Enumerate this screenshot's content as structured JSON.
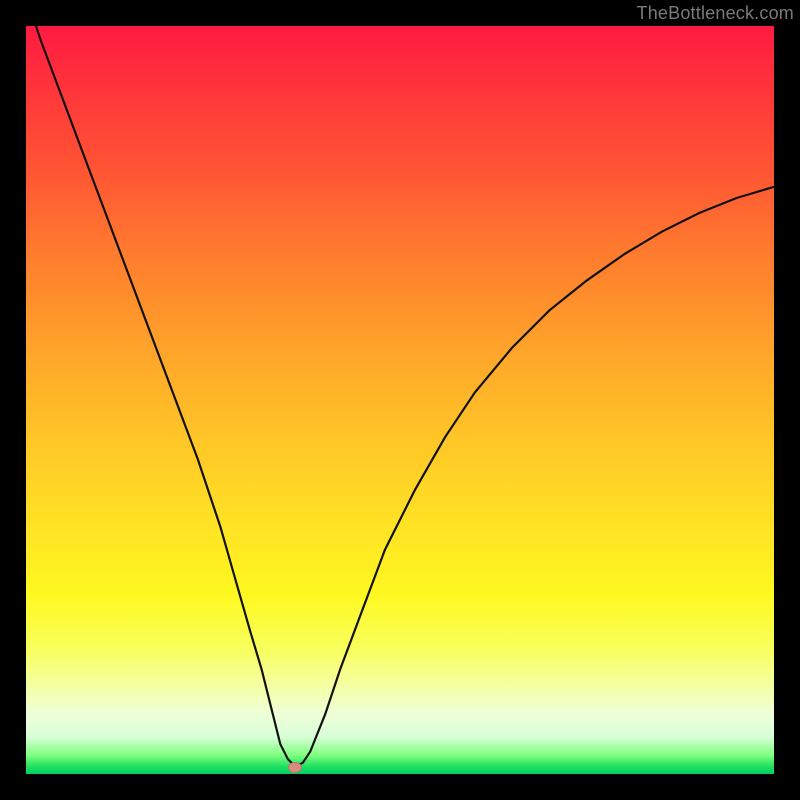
{
  "watermark": "TheBottleneck.com",
  "chart_data": {
    "type": "line",
    "title": "",
    "xlabel": "",
    "ylabel": "",
    "xlim": [
      0,
      100
    ],
    "ylim": [
      0,
      100
    ],
    "series": [
      {
        "name": "bottleneck-curve",
        "x": [
          0,
          2,
          5,
          8,
          11,
          14,
          17,
          20,
          23,
          26,
          28,
          30,
          31.5,
          33,
          34,
          35,
          36,
          37,
          38,
          40,
          42,
          45,
          48,
          52,
          56,
          60,
          65,
          70,
          75,
          80,
          85,
          90,
          95,
          100
        ],
        "y": [
          104,
          98,
          90,
          82,
          74,
          66,
          58,
          50,
          42,
          33,
          26,
          19,
          14,
          8,
          4,
          2,
          1,
          1.5,
          3,
          8,
          14,
          22,
          30,
          38,
          45,
          51,
          57,
          62,
          66,
          69.5,
          72.5,
          75,
          77,
          78.5
        ]
      }
    ],
    "markers": [
      {
        "name": "bottleneck-point",
        "x": 36,
        "y": 1,
        "color": "#d78d7f"
      }
    ],
    "background_gradient": {
      "top": "#ff1a40",
      "mid": "#ffe324",
      "bottom": "#00d060"
    }
  }
}
